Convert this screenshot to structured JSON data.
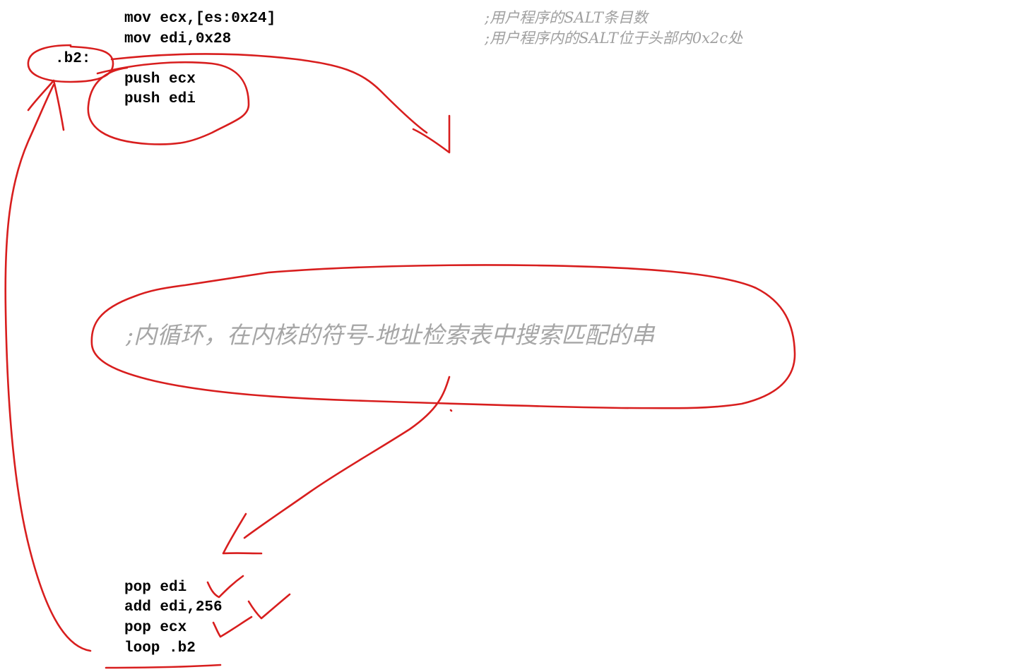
{
  "code_top": {
    "line1": "mov ecx,[es:0x24]",
    "line2": "mov edi,0x28",
    "label": ".b2:",
    "line3": "push ecx",
    "line4": "push edi"
  },
  "comments_top": {
    "line1": ";用户程序的SALT条目数",
    "line2": ";用户程序内的SALT位于头部内0x2c处"
  },
  "inner_loop_comment": ";内循环，在内核的符号-地址检索表中搜索匹配的串",
  "code_bottom": {
    "line1": "pop edi",
    "line2": "add edi,256",
    "line3": "pop ecx",
    "line4": "loop .b2"
  },
  "annotation_color": "#d81e1e"
}
